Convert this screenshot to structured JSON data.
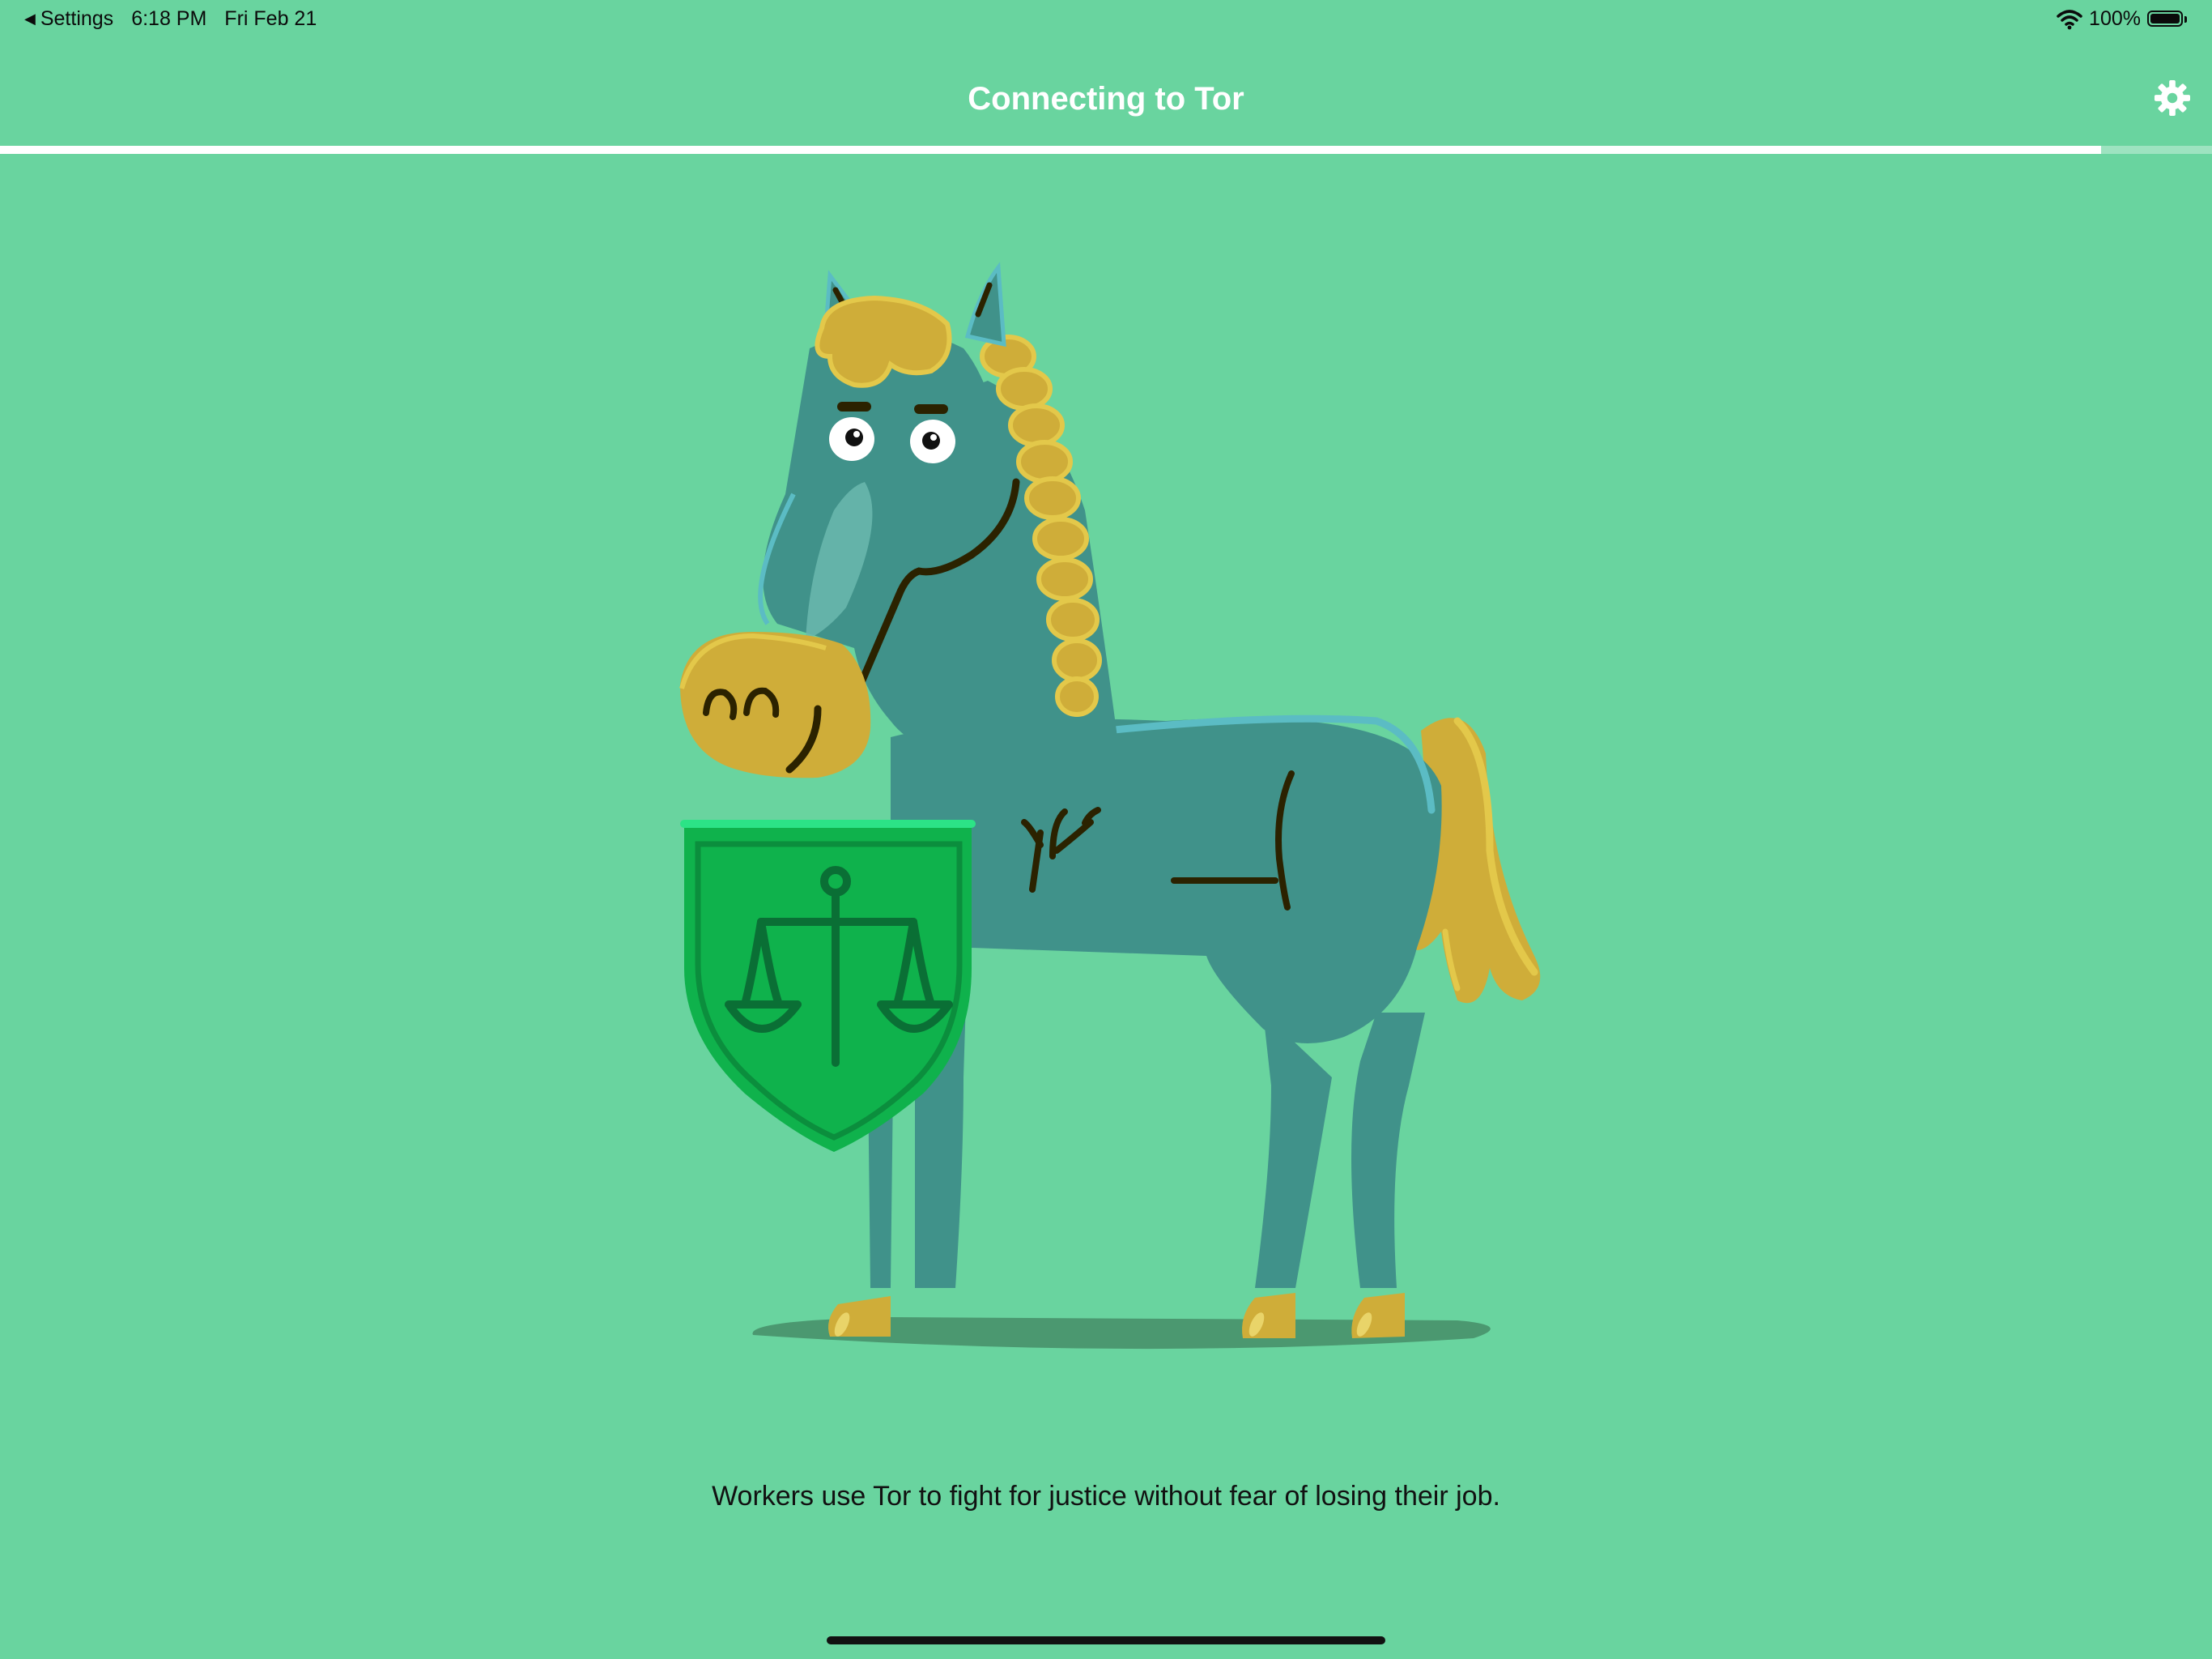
{
  "status_bar": {
    "back_label": "Settings",
    "time": "6:18 PM",
    "date": "Fri Feb 21",
    "battery": "100%",
    "battery_level": 1.0,
    "icons": [
      "back-caret-icon",
      "wifi-icon",
      "battery-icon"
    ]
  },
  "nav": {
    "title": "Connecting to Tor",
    "settings_icon": "gear-icon"
  },
  "progress": {
    "fraction": 0.95
  },
  "illustration": {
    "subject": "horse-with-shield-icon",
    "shield_symbol": "scales-of-justice-icon"
  },
  "caption": "Workers use Tor to fight for justice without fear of losing their job.",
  "colors": {
    "background": "#69d49f",
    "horse_body": "#40928a",
    "mane": "#cfad39",
    "shield": "#0fb24c",
    "shadow": "#4b9870"
  }
}
